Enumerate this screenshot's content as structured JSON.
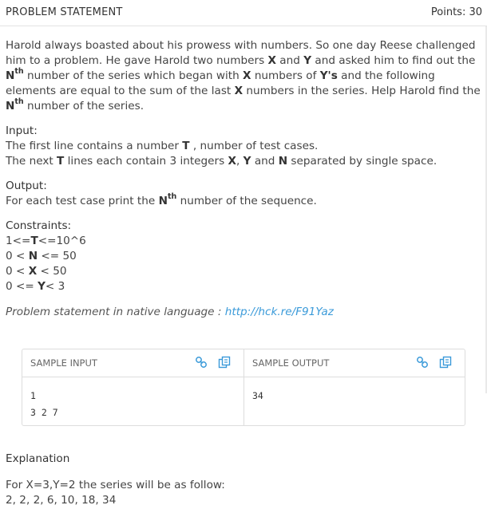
{
  "header": {
    "title": "PROBLEM STATEMENT",
    "points": "Points: 30"
  },
  "statement": {
    "p1": "Harold always boasted about his prowess with numbers. So one day Reese challenged him to a problem. He gave Harold two numbers ",
    "x": "X",
    "and": " and ",
    "y": "Y",
    "p2": " and asked him to find out the ",
    "n": "N",
    "th": "th",
    "p3": " number of the series which began with ",
    "x2": "X",
    "p4": " numbers of ",
    "ys": "Y's",
    "p5": " and the following elements are equal to the sum of the last ",
    "x3": "X",
    "p6": " numbers in the series. Help Harold find the ",
    "n2": "N",
    "th2": "th",
    "p7": " number of the series."
  },
  "input": {
    "title": "Input:",
    "l1a": "The first line contains a number ",
    "t": "T",
    "l1b": " , number of test cases.",
    "l2a": "The next ",
    "t2": "T",
    "l2b": " lines each contain 3 integers ",
    "x": "X",
    "c1": ", ",
    "y": "Y",
    "and": " and ",
    "n": "N",
    "l2c": " separated by single space."
  },
  "output": {
    "title": "Output:",
    "a": "For each test case print the ",
    "n": "N",
    "th": "th",
    "b": " number of the sequence."
  },
  "constraints": {
    "title": "Constraints:",
    "c1a": "1<=",
    "c1b": "T",
    "c1c": "<=10^6",
    "c2a": "0 < ",
    "c2b": "N",
    "c2c": " <= 50",
    "c3a": "0 < ",
    "c3b": "X",
    "c3c": " < 50",
    "c4a": "0 <= ",
    "c4b": "Y",
    "c4c": "< 3"
  },
  "native": {
    "label": "Problem statement in native language : ",
    "link": "http://hck.re/F91Yaz"
  },
  "sample": {
    "input_label": "SAMPLE INPUT",
    "output_label": "SAMPLE OUTPUT",
    "input_lines": "1\n3 2 7",
    "output_lines": "34"
  },
  "explanation": {
    "title": "Explanation",
    "line1": "For X=3,Y=2 the series will be as follow:",
    "line2": "2, 2, 2, 6, 10, 18, 34"
  },
  "colors": {
    "link": "#3a9ad9",
    "text": "#444444",
    "border": "#dddddd"
  }
}
